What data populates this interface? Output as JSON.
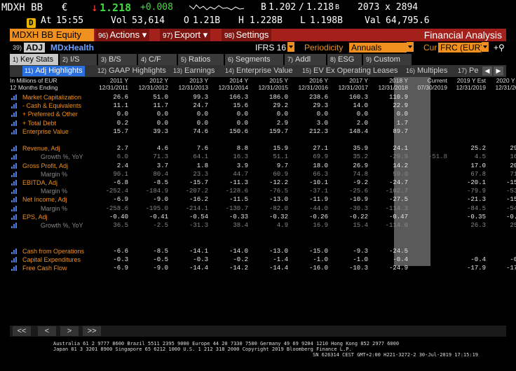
{
  "quote": {
    "ticker": "MDXH BB",
    "currency": "€",
    "last": "1.218",
    "change": "+0.008",
    "bid_label": "B",
    "bid": "1.202",
    "ask": "1.218",
    "ask_suffix": "B",
    "size": "2073 x 2894",
    "badge": "D",
    "at_label": "At",
    "time": "15:55",
    "vol_label": "Vol",
    "vol": "53,614",
    "open_label": "O",
    "open": "1.21B",
    "high_label": "H",
    "high": "1.228B",
    "low_label": "L",
    "low": "1.198B",
    "val_label": "Val",
    "val": "64,795.6"
  },
  "toolbar": {
    "security": "MDXH BB Equity",
    "actions_num": "96)",
    "actions": "Actions",
    "export_num": "97)",
    "export": "Export",
    "settings_num": "98)",
    "settings": "Settings",
    "title": "Financial Analysis"
  },
  "toolbar2": {
    "adj_num": "39)",
    "adj": "ADJ",
    "name": "MDxHealth",
    "ifrs": "IFRS 16",
    "periodicity_label": "Periodicity",
    "periodicity": "Annuals",
    "cur_label": "Cur",
    "cur": "FRC (EUR)"
  },
  "tabs": [
    {
      "n": "1)",
      "label": "Key Stats"
    },
    {
      "n": "2)",
      "label": "I/S"
    },
    {
      "n": "3)",
      "label": "B/S"
    },
    {
      "n": "4)",
      "label": "C/F"
    },
    {
      "n": "5)",
      "label": "Ratios"
    },
    {
      "n": "6)",
      "label": "Segments"
    },
    {
      "n": "7)",
      "label": "Addl"
    },
    {
      "n": "8)",
      "label": "ESG"
    },
    {
      "n": "9)",
      "label": "Custom"
    }
  ],
  "subtabs": [
    {
      "n": "11)",
      "label": "Adj Highlights"
    },
    {
      "n": "12)",
      "label": "GAAP Highlights"
    },
    {
      "n": "13)",
      "label": "Earnings"
    },
    {
      "n": "14)",
      "label": "Enterprise Value"
    },
    {
      "n": "15)",
      "label": "EV Ex Operating Leases"
    },
    {
      "n": "16)",
      "label": "Multiples"
    },
    {
      "n": "17)",
      "label": "Pe"
    }
  ],
  "table": {
    "unit": "In Millions of EUR",
    "period": "12 Months Ending",
    "columns": [
      {
        "h1": "2011 Y",
        "h2": "12/31/2011"
      },
      {
        "h1": "2012 Y",
        "h2": "12/31/2012"
      },
      {
        "h1": "2013 Y",
        "h2": "12/31/2013"
      },
      {
        "h1": "2014 Y",
        "h2": "12/31/2014"
      },
      {
        "h1": "2015 Y",
        "h2": "12/31/2015"
      },
      {
        "h1": "2016 Y",
        "h2": "12/31/2016"
      },
      {
        "h1": "2017 Y",
        "h2": "12/31/2017"
      },
      {
        "h1": "2018 Y",
        "h2": "12/31/2018"
      },
      {
        "h1": "Current",
        "h2": "07/30/2019"
      },
      {
        "h1": "2019 Y Est",
        "h2": "12/31/2019"
      },
      {
        "h1": "2020 Y Est",
        "h2": "12/31/2020"
      }
    ],
    "rows": [
      {
        "label": "Market Capitalization",
        "sub": false,
        "icon": true,
        "values": [
          "26.6",
          "51.0",
          "99.3",
          "166.3",
          "186.0",
          "238.6",
          "160.3",
          "110.9",
          "73.0",
          "",
          ""
        ]
      },
      {
        "label": "- Cash & Equivalents",
        "sub": false,
        "icon": true,
        "values": [
          "11.1",
          "11.7",
          "24.7",
          "15.6",
          "29.2",
          "29.3",
          "14.0",
          "22.9",
          "22.9",
          "",
          ""
        ]
      },
      {
        "label": "+ Preferred & Other",
        "sub": false,
        "icon": true,
        "values": [
          "0.0",
          "0.0",
          "0.0",
          "0.0",
          "0.0",
          "0.0",
          "0.0",
          "0.0",
          "0.0",
          "",
          ""
        ]
      },
      {
        "label": "+ Total Debt",
        "sub": false,
        "icon": true,
        "values": [
          "0.2",
          "0.0",
          "0.0",
          "0.0",
          "2.9",
          "3.0",
          "2.0",
          "1.7",
          "1.7",
          "",
          ""
        ]
      },
      {
        "label": "Enterprise Value",
        "sub": false,
        "icon": true,
        "values": [
          "15.7",
          "39.3",
          "74.6",
          "150.6",
          "159.7",
          "212.3",
          "148.4",
          "89.7",
          "51.8",
          "",
          ""
        ]
      },
      {
        "label": "",
        "sub": false,
        "icon": false,
        "values": [
          "",
          "",
          "",
          "",
          "",
          "",
          "",
          "",
          "",
          "",
          ""
        ]
      },
      {
        "label": "Revenue, Adj",
        "sub": false,
        "icon": true,
        "values": [
          "2.7",
          "4.6",
          "7.6",
          "8.8",
          "15.9",
          "27.1",
          "35.9",
          "24.1",
          "",
          "25.2",
          "29.4"
        ]
      },
      {
        "label": "Growth %, YoY",
        "sub": true,
        "icon": true,
        "values": [
          "6.0",
          "71.3",
          "64.1",
          "16.3",
          "51.1",
          "69.9",
          "35.2",
          "-29.9",
          "-51.8",
          "4.5",
          "16.7"
        ]
      },
      {
        "label": "Gross Profit, Adj",
        "sub": false,
        "icon": true,
        "values": [
          "2.4",
          "3.7",
          "1.8",
          "3.9",
          "9.7",
          "18.0",
          "26.9",
          "14.2",
          "",
          "17.0",
          "20.8"
        ]
      },
      {
        "label": "Margin %",
        "sub": true,
        "icon": true,
        "values": [
          "90.1",
          "80.4",
          "23.3",
          "44.7",
          "60.9",
          "66.3",
          "74.8",
          "59.0",
          "",
          "67.8",
          "71.0"
        ]
      },
      {
        "label": "EBITDA, Adj",
        "sub": false,
        "icon": true,
        "values": [
          "-6.8",
          "-8.5",
          "-15.7",
          "-11.3",
          "-12.2",
          "-10.1",
          "-9.2",
          "-24.7",
          "",
          "-20.1",
          "-15.7"
        ]
      },
      {
        "label": "Margin %",
        "sub": true,
        "icon": true,
        "values": [
          "-252.4",
          "-184.9",
          "-207.2",
          "-128.6",
          "-76.5",
          "-37.1",
          "-25.6",
          "-102.7",
          "",
          "-79.9",
          "-53.5"
        ]
      },
      {
        "label": "Net Income, Adj",
        "sub": false,
        "icon": true,
        "values": [
          "-6.9",
          "-9.0",
          "-16.2",
          "-11.5",
          "-13.0",
          "-11.9",
          "-10.9",
          "-27.5",
          "",
          "-21.3",
          "-15.9"
        ]
      },
      {
        "label": "Margin %",
        "sub": true,
        "icon": true,
        "values": [
          "-258.6",
          "-195.0",
          "-214.1",
          "-130.7",
          "-82.0",
          "-44.0",
          "-30.3",
          "-114.3",
          "",
          "-84.5",
          "-54.0"
        ]
      },
      {
        "label": "EPS, Adj",
        "sub": false,
        "icon": true,
        "values": [
          "-0.40",
          "-0.41",
          "-0.54",
          "-0.33",
          "-0.32",
          "-0.26",
          "-0.22",
          "-0.47",
          "",
          "-0.35",
          "-0.26"
        ]
      },
      {
        "label": "Growth %, YoY",
        "sub": true,
        "icon": true,
        "values": [
          "36.5",
          "-2.5",
          "-31.3",
          "38.4",
          "4.9",
          "16.9",
          "15.4",
          "-114.0",
          "",
          "26.3",
          "25.7"
        ]
      },
      {
        "label": "",
        "sub": false,
        "icon": false,
        "values": [
          "",
          "",
          "",
          "",
          "",
          "",
          "",
          "",
          "",
          "",
          ""
        ]
      },
      {
        "label": "",
        "sub": false,
        "icon": false,
        "values": [
          "",
          "",
          "",
          "",
          "",
          "",
          "",
          "",
          "",
          "",
          ""
        ]
      },
      {
        "label": "Cash from Operations",
        "sub": false,
        "icon": true,
        "values": [
          "-6.6",
          "-8.5",
          "-14.1",
          "-14.0",
          "-13.0",
          "-15.0",
          "-9.3",
          "-24.5",
          "",
          "",
          ""
        ]
      },
      {
        "label": "Capital Expenditures",
        "sub": false,
        "icon": true,
        "values": [
          "-0.3",
          "-0.5",
          "-0.3",
          "-0.2",
          "-1.4",
          "-1.0",
          "-1.0",
          "-0.4",
          "",
          "-0.4",
          "-0.4"
        ]
      },
      {
        "label": "Free Cash Flow",
        "sub": false,
        "icon": true,
        "values": [
          "-6.9",
          "-9.0",
          "-14.4",
          "-14.2",
          "-14.4",
          "-16.0",
          "-10.3",
          "-24.9",
          "",
          "-17.9",
          "-17.6"
        ]
      }
    ]
  },
  "pager": [
    "<<",
    "<",
    ">",
    ">>"
  ],
  "footer": {
    "line1": "Australia 61 2 9777 8600 Brazil 5511 2395 9000 Europe 44 20 7330 7500 Germany 49 69 9204 1210 Hong Kong 852 2977 6000",
    "line2": "Japan 81 3 3201 8900        Singapore 65 6212 1000         U.S. 1 212 318 2000            Copyright 2019 Bloomberg Finance L.P.",
    "line3": "SN 626314 CEST  GMT+2:00 H221-3272-2 30-Jul-2019 17:15:19"
  },
  "colors": {
    "accent_orange": "#f0901e",
    "bar_red": "#a4201a",
    "up_green": "#3ddc3d",
    "down_red": "#ff3b2f",
    "active_blue": "#2a6fe0"
  }
}
